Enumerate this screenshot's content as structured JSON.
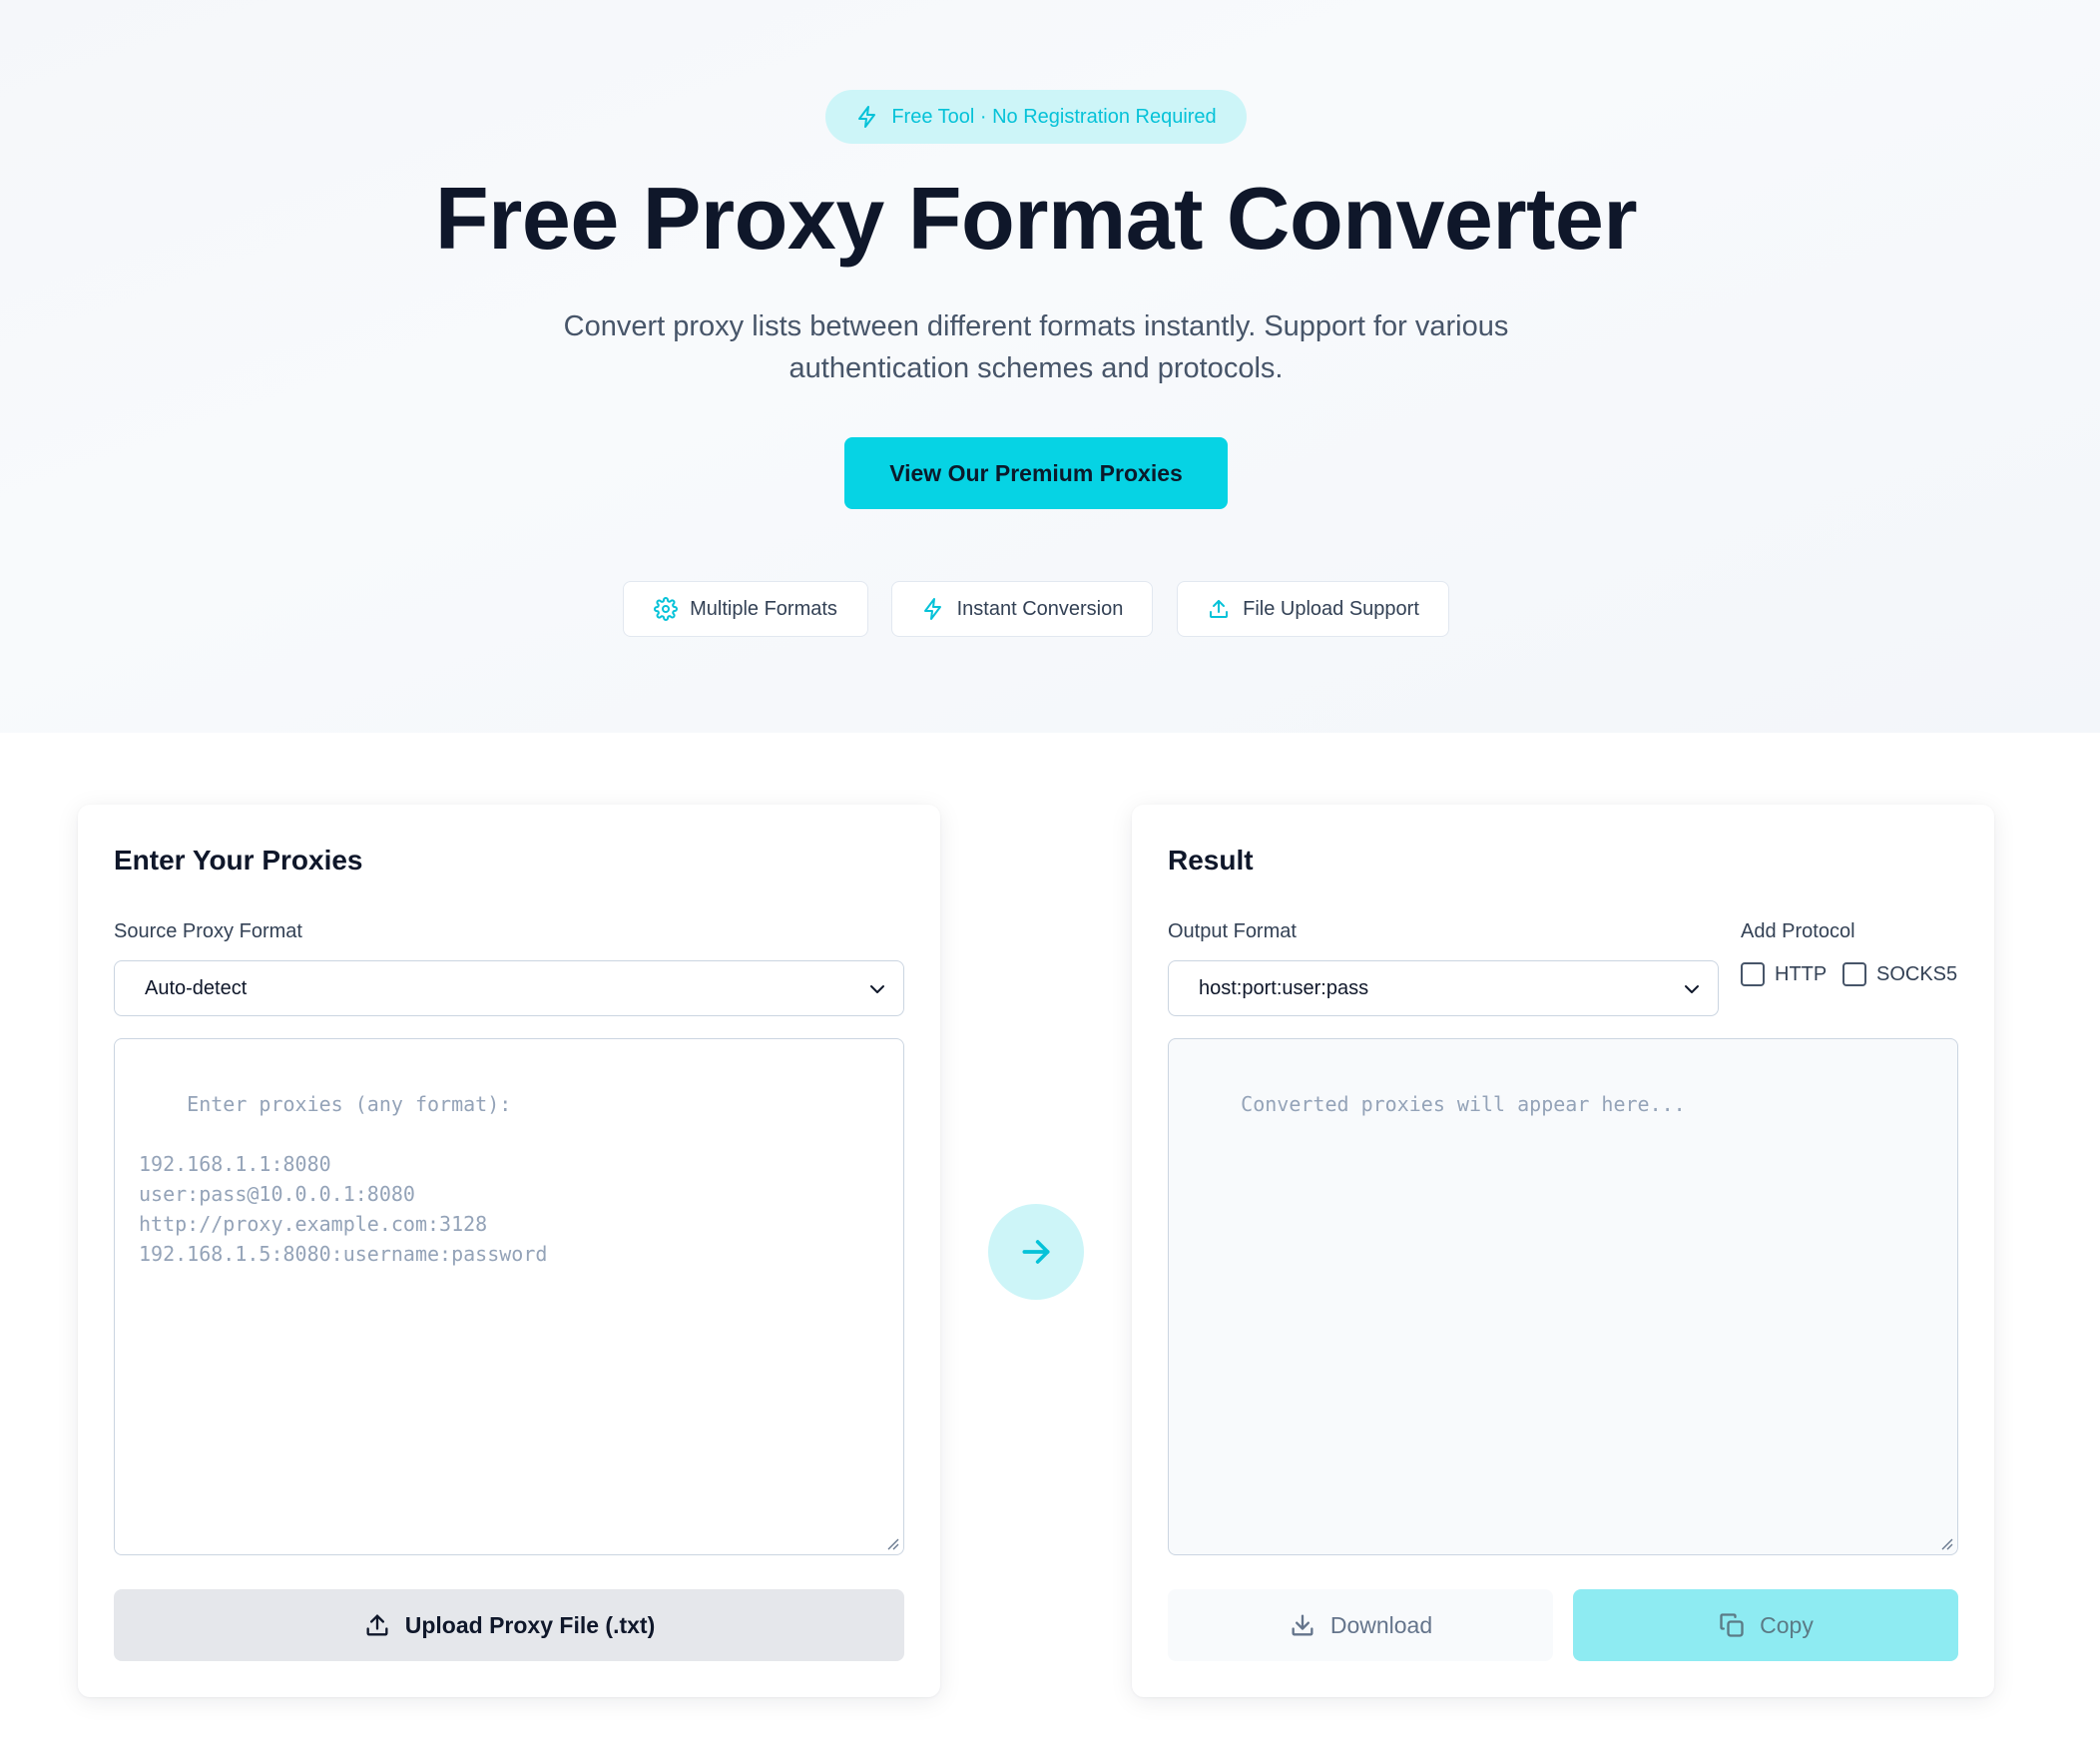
{
  "hero": {
    "badge": "Free Tool · No Registration Required",
    "title": "Free Proxy Format Converter",
    "subtitle": "Convert proxy lists between different formats instantly. Support for various authentication schemes and protocols.",
    "cta_label": "View Our Premium Proxies",
    "features": [
      {
        "label": "Multiple Formats",
        "icon": "gear-icon"
      },
      {
        "label": "Instant Conversion",
        "icon": "lightning-icon"
      },
      {
        "label": "File Upload Support",
        "icon": "upload-icon"
      }
    ]
  },
  "input_panel": {
    "title": "Enter Your Proxies",
    "source_label": "Source Proxy Format",
    "source_value": "Auto-detect",
    "placeholder": "Enter proxies (any format):\n\n192.168.1.1:8080\nuser:pass@10.0.0.1:8080\nhttp://proxy.example.com:3128\n192.168.1.5:8080:username:password",
    "upload_label": "Upload Proxy File (.txt)"
  },
  "result_panel": {
    "title": "Result",
    "output_label": "Output Format",
    "output_value": "host:port:user:pass",
    "protocol_label": "Add Protocol",
    "protocols": [
      "HTTP",
      "SOCKS5"
    ],
    "placeholder": "Converted proxies will appear here...",
    "download_label": "Download",
    "copy_label": "Copy"
  },
  "colors": {
    "accent": "#06d3e4",
    "accent_light": "#cdf5f8",
    "accent_text": "#06c2d8",
    "copy_disabled": "#8eebf2",
    "title_text": "#0f172a"
  }
}
